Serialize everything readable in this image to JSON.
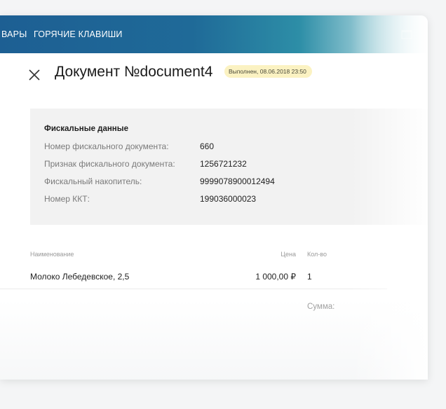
{
  "topbar": {
    "nav": [
      "ВАРЫ",
      "ГОРЯЧИЕ КЛАВИШИ"
    ],
    "right_icon": "box-icon"
  },
  "header": {
    "close_icon": "close-icon",
    "title": "Документ №document4",
    "status": "Выполнен, 08.06.2018 23:50"
  },
  "fiscal": {
    "heading": "Фискальные данные",
    "rows": [
      {
        "label": "Номер фискального документа:",
        "value": "660"
      },
      {
        "label": "Признак фискального документа:",
        "value": "1256721232"
      },
      {
        "label": "Фискальный накопитель:",
        "value": "9999078900012494"
      },
      {
        "label": "Номер ККТ:",
        "value": "199036000023"
      }
    ]
  },
  "table": {
    "columns": {
      "name": "Наименование",
      "price": "Цена",
      "qty": "Кол-во"
    },
    "rows": [
      {
        "name": "Молоко Лебедевское, 2,5",
        "price": "1 000,00 ₽",
        "qty": "1"
      }
    ],
    "sum_label": "Сумма:"
  },
  "colors": {
    "topbar_start": "#1d5f93",
    "topbar_end": "#f3fafb",
    "status_badge_bg": "#fbf2c2",
    "panel_bg": "#f2f2f2"
  }
}
